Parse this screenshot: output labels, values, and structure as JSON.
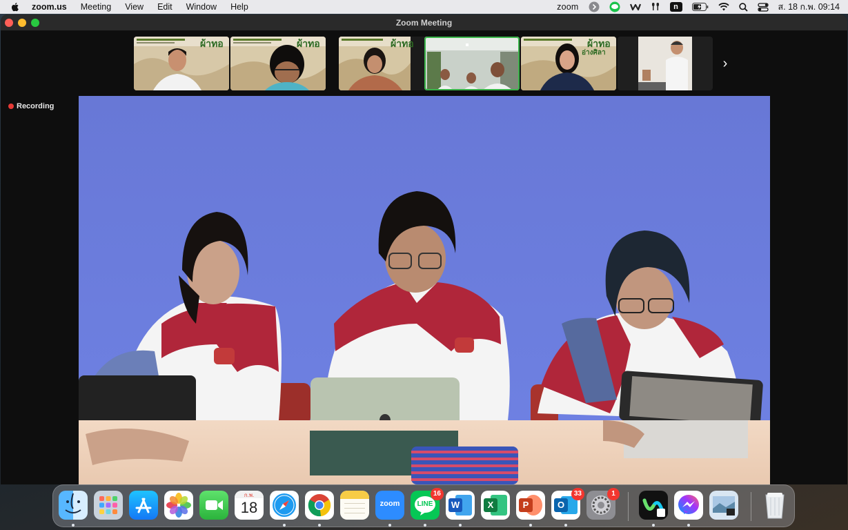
{
  "menubar": {
    "apple_icon": "apple-icon",
    "items": [
      "zoom.us",
      "Meeting",
      "View",
      "Edit",
      "Window",
      "Help"
    ],
    "tray_zoom_text": "zoom",
    "tray_n": "n",
    "clock": "ส. 18 ก.พ.  09:14"
  },
  "window": {
    "title": "Zoom Meeting",
    "recording_label": "Recording"
  },
  "thumbnails": [
    {
      "id": "participant-1",
      "banner_text": "ผ้าทอ"
    },
    {
      "id": "participant-2",
      "banner_text": "ผ้าทอ"
    },
    {
      "id": "participant-3",
      "banner_text": "ผ้าทอ"
    },
    {
      "id": "participant-4",
      "active": true
    },
    {
      "id": "participant-5",
      "banner_text": "ผ้าทอ",
      "banner_sub": "อ่างศิลา"
    },
    {
      "id": "participant-6"
    }
  ],
  "thumbnail_banner_sub": "อ่างศิลา",
  "next_arrow": "›",
  "dock": {
    "calendar_month": "ก.พ.",
    "calendar_day": "18",
    "zoom_label": "zoom",
    "line_label": "LINE",
    "line_badge": "16",
    "outlook_badge": "33",
    "settings_badge": "1",
    "word_letter": "W",
    "excel_letter": "X",
    "ppt_letter": "P",
    "outlook_letter": "O"
  },
  "colors": {
    "accent_green": "#3ab54a",
    "recording_red": "#e53935",
    "video_backdrop": "#6e7fd8",
    "shirt_red": "#b0263a"
  }
}
